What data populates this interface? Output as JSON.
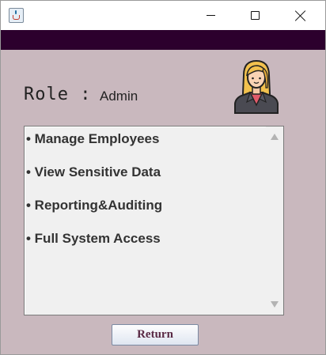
{
  "window": {
    "title": "",
    "controls": {
      "minimize_icon": "minimize-icon",
      "maximize_icon": "maximize-icon",
      "close_icon": "close-icon"
    }
  },
  "colors": {
    "header_bar": "#2c002d",
    "background": "#c9b8be",
    "list_background": "#f0f0f0",
    "button_text": "#5a2a45"
  },
  "role": {
    "label": "Role :",
    "value": "Admin"
  },
  "avatar": {
    "icon": "businesswoman-avatar-icon"
  },
  "permissions": {
    "items": [
      "• Manage Employees",
      "• View Sensitive Data",
      "• Reporting&Auditing",
      "• Full System Access"
    ]
  },
  "actions": {
    "return_label": "Return"
  }
}
